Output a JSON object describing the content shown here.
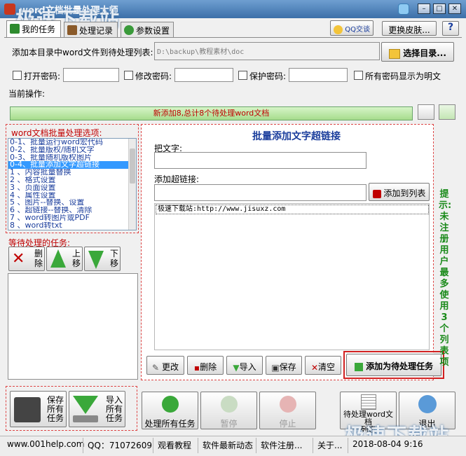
{
  "window": {
    "title": "word文档批量处理大师",
    "watermark": "极速下载站"
  },
  "header": {
    "qq_label": "QQ交谈",
    "change_skin": "更换皮肤..."
  },
  "tabs": [
    {
      "label": "我的任务"
    },
    {
      "label": "处理记录"
    },
    {
      "label": "参数设置"
    }
  ],
  "dir_row": {
    "label": "添加本目录中word文件到待处理列表:",
    "path": "D:\\backup\\教程素材\\doc",
    "select_button": "选择目录..."
  },
  "passwords": {
    "open": "打开密码:",
    "modify": "修改密码:",
    "protect": "保护密码:",
    "show_plain": "所有密码显示为明文"
  },
  "current_op": {
    "label": "当前操作:",
    "progress_text": "新添加8,总计8个待处理word文档"
  },
  "options": {
    "title": "word文档批量处理选项:",
    "items": [
      "0-1、批量运行word宏代码",
      "0-2、批量版权/随机文字",
      "0-3、批量随机版权图片",
      "0-4、批量添加文字超链接",
      "1 、内容批量替换",
      "2 、格式设置",
      "3 、页面设置",
      "4 、属性设置",
      "5 、图片--替换、设置",
      "6 、超链接--替换、清除",
      "7 、word转图片或PDF",
      "8 、word转txt"
    ],
    "selected_index": 3
  },
  "tasks": {
    "title": "等待处理的任务:",
    "delete": [
      "删",
      "除"
    ],
    "up": [
      "上",
      "移"
    ],
    "down": [
      "下",
      "移"
    ]
  },
  "panel": {
    "title": "批量添加文字超链接",
    "text_label": "把文字:",
    "link_label": "添加超链接:",
    "add_to_list": "添加到列表",
    "list_entry": "极速下载站:http://www.jisuxz.com",
    "buttons": {
      "edit": "更改",
      "delete": "删除",
      "import": "导入",
      "save": "保存",
      "clear": "清空"
    },
    "add_task": "添加为待处理任务"
  },
  "tip": "提示:未注册用户最多使用3个列表项",
  "bottom": {
    "save_tasks": [
      "保存",
      "所有",
      "任务"
    ],
    "import_tasks": [
      "导入",
      "所有",
      "任务"
    ],
    "process_all": "处理所有任务",
    "pause": "暂停",
    "stop": "停止",
    "pending_list": [
      "待处理",
      "word文档",
      "列表"
    ],
    "exit": "退出"
  },
  "statusbar": {
    "site": "www.001help.com",
    "qq": "QQ：71072609",
    "tutorial": "观看教程",
    "news": "软件最新动态",
    "register": "软件注册...",
    "about": "关于...",
    "datetime": "2018-08-04  9:16"
  },
  "colors": {
    "accent_red": "#c00000",
    "link_blue": "#1a3d9c",
    "tip_green": "#1a8a1a",
    "titlebar": "#3c6fa8"
  }
}
